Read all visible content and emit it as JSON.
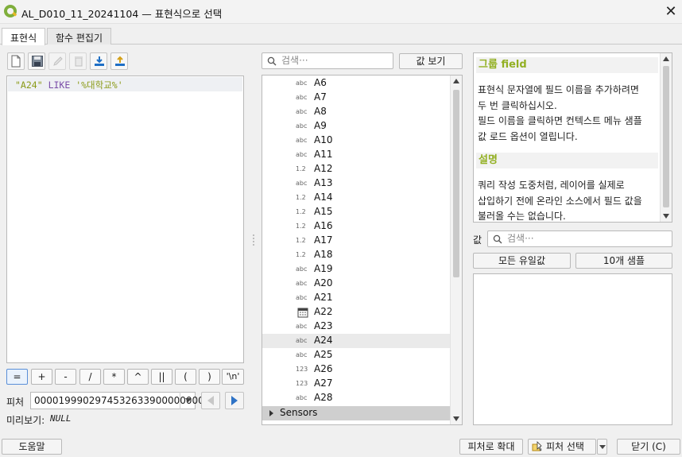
{
  "window": {
    "title": "AL_D010_11_20241104 — 표현식으로 선택",
    "close": "✕"
  },
  "tabs": [
    {
      "label": "표현식",
      "active": true
    },
    {
      "label": "함수 편집기",
      "active": false
    }
  ],
  "editor": {
    "field": "\"A24\"",
    "keyword": "LIKE",
    "string": "'%대학교%'"
  },
  "operators": [
    "=",
    "+",
    "-",
    "/",
    "*",
    "^",
    "||",
    "(",
    ")",
    "'\\n'"
  ],
  "feature": {
    "label": "피처",
    "value": "0000199902974532633900000000",
    "preview_label": "미리보기:",
    "preview_value": "NULL"
  },
  "search": {
    "placeholder": "검색···",
    "show_values": "값 보기"
  },
  "fields": [
    {
      "type": "abc",
      "name": "A6"
    },
    {
      "type": "abc",
      "name": "A7"
    },
    {
      "type": "abc",
      "name": "A8"
    },
    {
      "type": "abc",
      "name": "A9"
    },
    {
      "type": "abc",
      "name": "A10"
    },
    {
      "type": "abc",
      "name": "A11"
    },
    {
      "type": "1.2",
      "name": "A12"
    },
    {
      "type": "abc",
      "name": "A13"
    },
    {
      "type": "1.2",
      "name": "A14"
    },
    {
      "type": "1.2",
      "name": "A15"
    },
    {
      "type": "1.2",
      "name": "A16"
    },
    {
      "type": "1.2",
      "name": "A17"
    },
    {
      "type": "1.2",
      "name": "A18"
    },
    {
      "type": "abc",
      "name": "A19"
    },
    {
      "type": "abc",
      "name": "A20"
    },
    {
      "type": "abc",
      "name": "A21"
    },
    {
      "type": "calendar-icon",
      "name": "A22"
    },
    {
      "type": "abc",
      "name": "A23"
    },
    {
      "type": "abc",
      "name": "A24",
      "selected": true
    },
    {
      "type": "abc",
      "name": "A25"
    },
    {
      "type": "123",
      "name": "A26"
    },
    {
      "type": "123",
      "name": "A27"
    },
    {
      "type": "abc",
      "name": "A28"
    }
  ],
  "group": {
    "name": "Sensors"
  },
  "help": {
    "title": "그룹 field",
    "body": [
      "표현식 문자열에 필드 이름을 추가하려면",
      "두 번 클릭하십시오.",
      "필드 이름을 클릭하면 컨텍스트 메뉴 샘플",
      "값 로드 옵션이 열립니다."
    ],
    "section": "설명",
    "section_body": [
      "쿼리 작성 도중처럼, 레이어를 실제로",
      "삽입하기 전에 온라인 소스에서 필드 값을",
      "불러올 수는 없습니다."
    ]
  },
  "values_panel": {
    "label": "값",
    "search_placeholder": "검색···",
    "all_unique": "모든 유일값",
    "sample": "10개 샘플"
  },
  "footer": {
    "help": "도움말",
    "zoom": "피처로 확대",
    "select": "피처 선택",
    "close": "닫기 (C)"
  }
}
